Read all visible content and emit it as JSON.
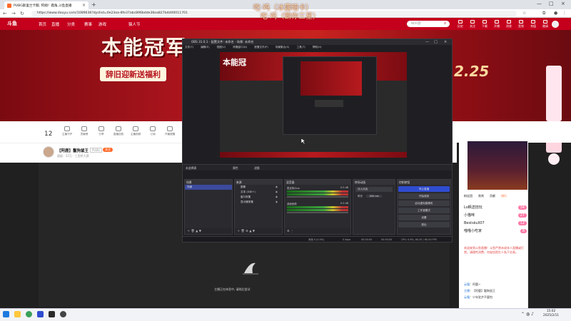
{
  "browser": {
    "tab_title": "PUBG斯里兰卡服, 阿姆！鹿角,斗鱼直播",
    "url": "https://www.douyu.com/1089636?dyshid=0e23ea-8fe37abc896bdde36ea827b4d00011701",
    "window_controls": [
      "—",
      "□",
      "×"
    ],
    "nav": [
      "←",
      "→",
      "↻"
    ]
  },
  "site": {
    "logo": "斗鱼",
    "nav_links": [
      "首页",
      "直播",
      "分类",
      "赛事",
      "游戏",
      "猿人节"
    ],
    "promo_badge": "猿人节",
    "search_placeholder": "WiFi游",
    "top_icons": [
      "历史",
      "关注",
      "下载",
      "开播",
      "消息",
      "签到",
      "充值",
      "邀请",
      "任务"
    ]
  },
  "banner": {
    "headline": "本能冠军",
    "subline": "辞旧迎新送福利",
    "date": "2.25",
    "overlay_line1": "吃·鸡（冰露暗卡）",
    "overlay_line2": "吃·鸡（霸你三星）"
  },
  "anchor_bar": {
    "level": "12",
    "icons": [
      "主播守护",
      "贡献榜",
      "分享",
      "直播回放",
      "主播视频",
      "订阅",
      "开播提醒",
      "水中鱼",
      "抗疫知识"
    ],
    "pc_button": "PC客户端"
  },
  "host": {
    "name": "【阿鹿】鬣狗鼠王",
    "tag1": "PUBG",
    "tag2": "关注",
    "meta": "超级 · 22万 · 三国杀大赛"
  },
  "video": {
    "loading_text": "主播正在休息中, 请稍后尝试"
  },
  "obs": {
    "title": "OBS 31.0.1 - 配置文件: 未命名 - 场景: 未命名",
    "menu": [
      "文件(F)",
      "编辑(E)",
      "视图(V)",
      "停靠窗口(D)",
      "配置文件(P)",
      "场景集合(S)",
      "工具(T)",
      "帮助(H)"
    ],
    "toolbar_label": "未选择源",
    "toolbar_props": "属性",
    "toolbar_filter": "滤镜",
    "docks": {
      "scenes": {
        "title": "场景",
        "items": [
          "场景"
        ]
      },
      "sources": {
        "title": "来源",
        "items": [
          "图像",
          "文本 (GDI+)",
          "窗口采集",
          "显示器采集"
        ]
      },
      "mixer": {
        "title": "混音器",
        "rows": [
          {
            "name": "桌面音频",
            "level": "0.0 dB"
          },
          {
            "name": "麦克风/Aux",
            "level": "0.0 dB"
          }
        ]
      },
      "transitions": {
        "title": "转场动画",
        "type": "淡入淡出",
        "duration_label": "时长",
        "duration": "300 ms"
      },
      "controls": {
        "title": "控制按钮",
        "buttons": [
          "停止直播",
          "开始录制",
          "启动虚拟摄像机",
          "工作室模式",
          "设置",
          "退出"
        ]
      }
    },
    "status": {
      "dropped": "丢帧 0 (0.0%)",
      "bitrate": "0 kbps",
      "live": "00:00:00",
      "rec": "00:00:00",
      "cpu": "CPU: 0.6%, 60.00 / 60.00 FPS"
    }
  },
  "sidebar": {
    "tabs": [
      "粉丝团",
      "贵宾",
      "贡献",
      "排行"
    ],
    "rank_items": [
      {
        "name": "Lo枫送挂玩",
        "badge": "34"
      },
      {
        "name": "小猫咪",
        "badge": "27"
      },
      {
        "name": "Bestskull07",
        "badge": "12"
      },
      {
        "name": "喵喵小吃家",
        "badge": "8"
      }
    ],
    "notice": "欢迎来到斗鱼直播！斗鱼严禁未成年人直播或打赏。请理性消费，勿轻信陌生人私下交易。",
    "chat": [
      {
        "user": "云霜",
        "text": "阿鹿~"
      },
      {
        "user": "主播",
        "text": "【阿鹿】鬣狗鼠王"
      },
      {
        "user": "云霜",
        "text": "少年驻步不要怕"
      }
    ]
  },
  "taskbar": {
    "time": "15:02",
    "date": "2025/2/11"
  },
  "colors": {
    "brand_red": "#c4001c",
    "obs_bg": "#1f1f23",
    "obs_primary": "#2f4cd0",
    "accent_orange": "#ff6a2a"
  }
}
